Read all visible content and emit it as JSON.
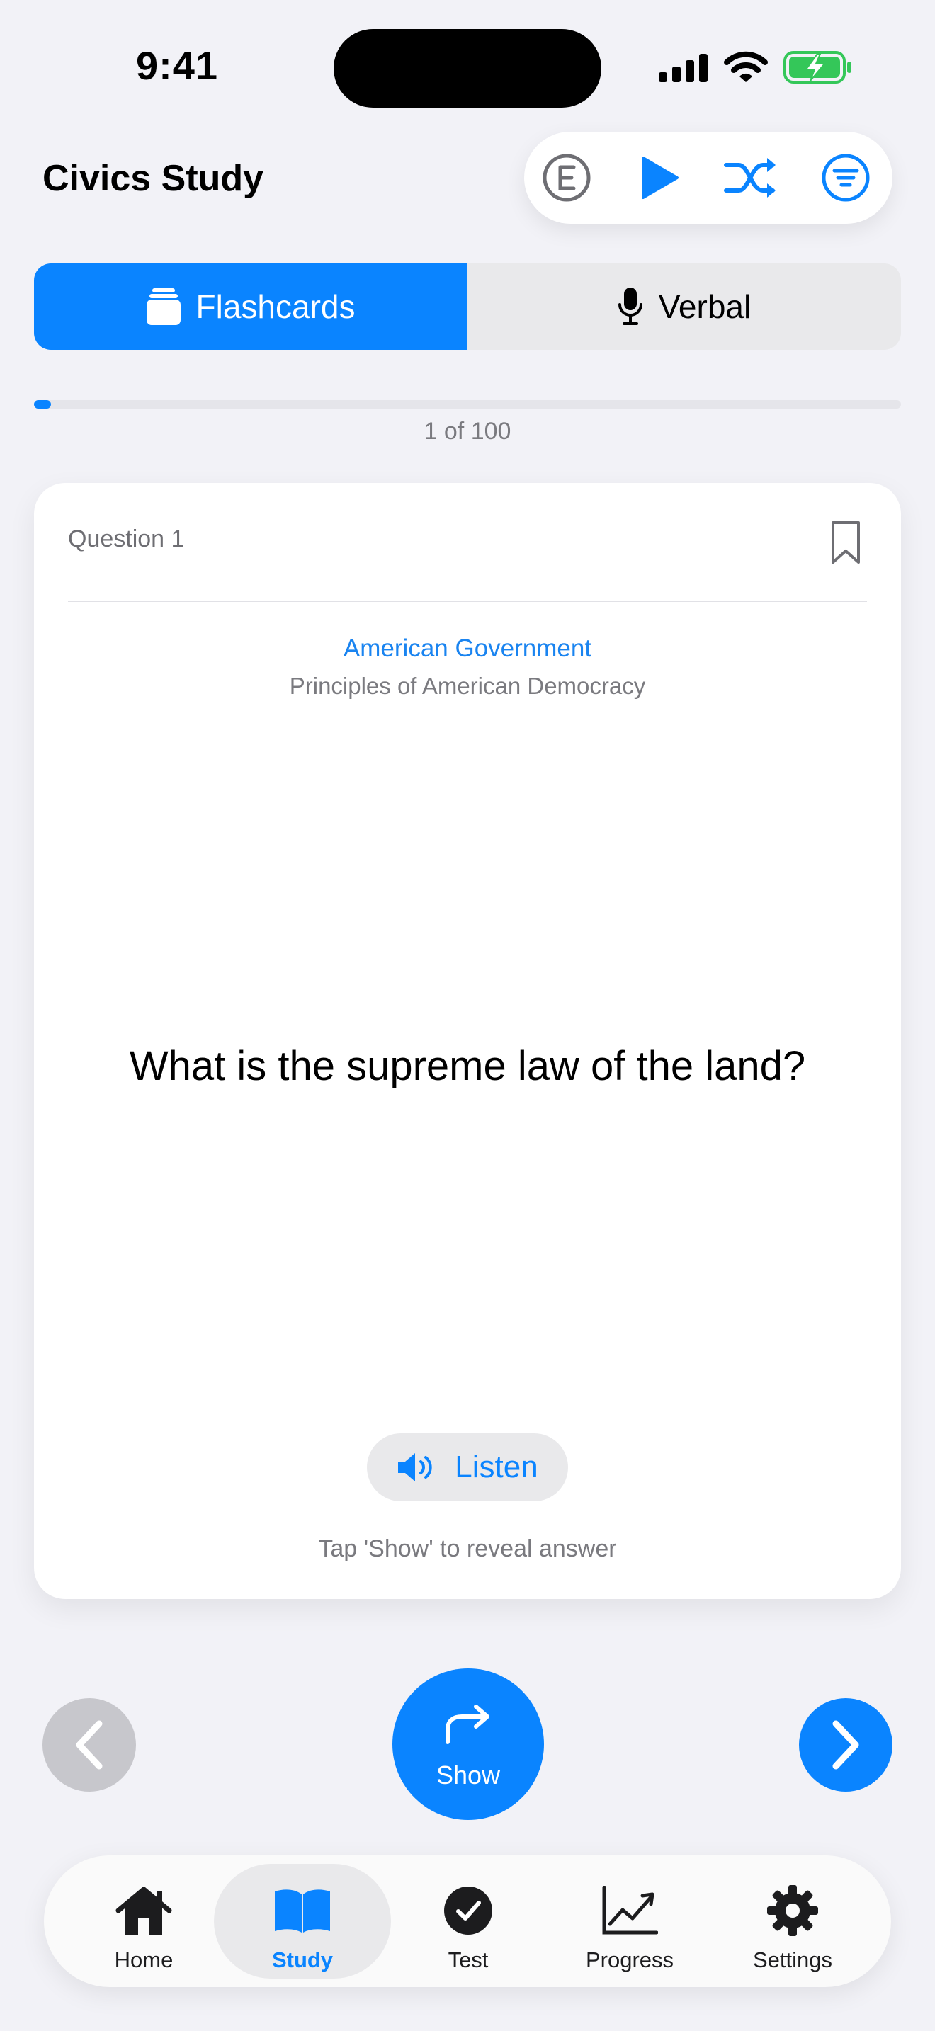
{
  "status_bar": {
    "time": "9:41"
  },
  "header": {
    "title": "Civics Study",
    "toolbar_icons": [
      "e-circle-icon",
      "play-icon",
      "shuffle-icon",
      "filter-icon"
    ]
  },
  "segmented": {
    "flashcards_label": "Flashcards",
    "verbal_label": "Verbal",
    "selected": "Flashcards"
  },
  "progress": {
    "text": "1 of 100",
    "current": 1,
    "total": 100
  },
  "card": {
    "question_number": "Question 1",
    "category": "American Government",
    "subcategory": "Principles of American Democracy",
    "question": "What is the supreme law of the land?",
    "listen_label": "Listen",
    "hint": "Tap 'Show' to reveal answer"
  },
  "controls": {
    "show_label": "Show"
  },
  "tabbar": {
    "items": [
      {
        "label": "Home",
        "icon": "house-icon"
      },
      {
        "label": "Study",
        "icon": "book-icon",
        "active": true
      },
      {
        "label": "Test",
        "icon": "checkmark-circle-icon"
      },
      {
        "label": "Progress",
        "icon": "chart-line-icon"
      },
      {
        "label": "Settings",
        "icon": "gear-icon"
      }
    ]
  },
  "colors": {
    "accent": "#0A84FF",
    "battery": "#34C759",
    "background": "#F2F2F7"
  }
}
